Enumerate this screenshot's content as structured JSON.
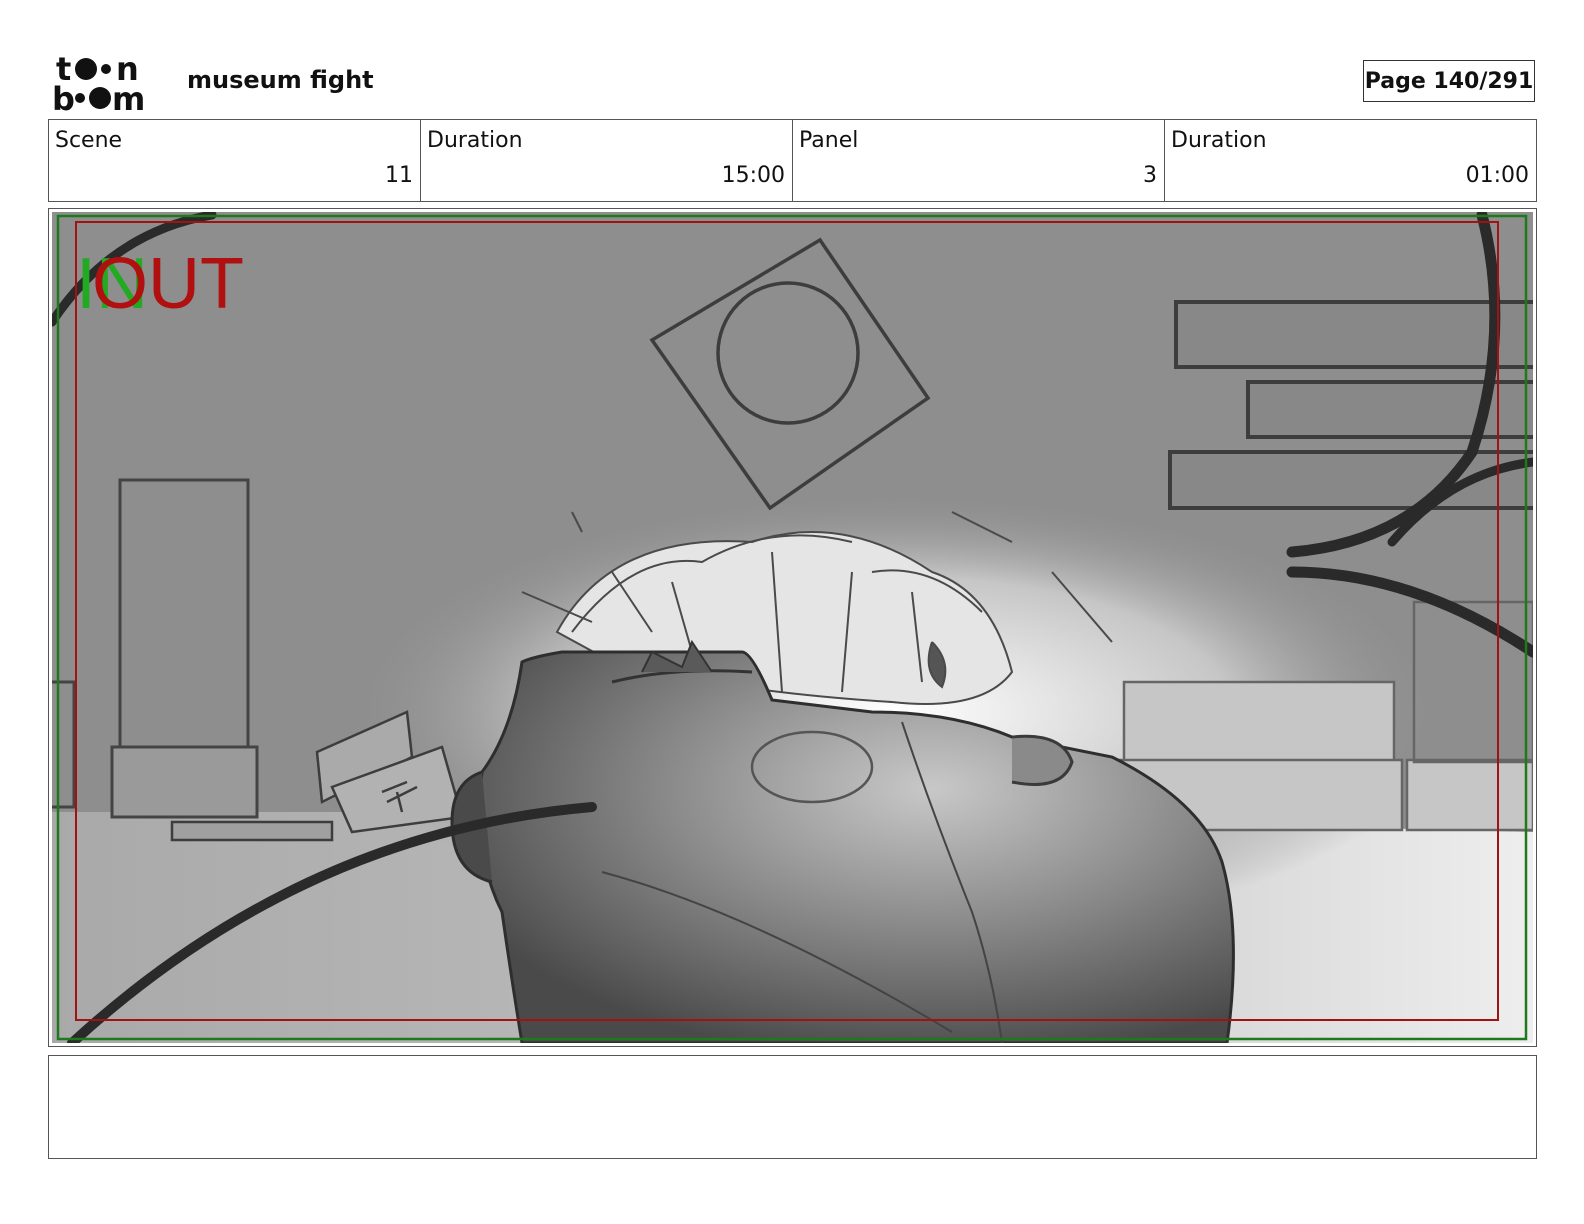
{
  "header": {
    "logo_alt": "toon boom",
    "title": "museum fight",
    "page_label": "Page 140/291"
  },
  "info": {
    "scene_label": "Scene",
    "scene_value": "11",
    "scene_duration_label": "Duration",
    "scene_duration_value": "15:00",
    "panel_label": "Panel",
    "panel_value": "3",
    "panel_duration_label": "Duration",
    "panel_duration_value": "01:00"
  },
  "panel": {
    "in_marker": "IN",
    "out_marker": "OUT",
    "in_color": "#22aa22",
    "out_color": "#b01010"
  },
  "notes": {
    "text": ""
  }
}
